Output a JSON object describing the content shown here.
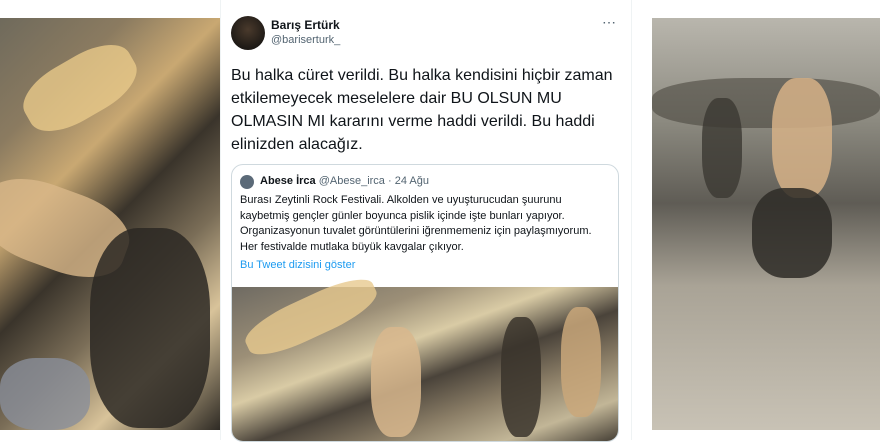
{
  "images": {
    "left": "crowd-photo-left",
    "right": "crowd-photo-right"
  },
  "tweet": {
    "author_name": "Barış Ertürk",
    "author_handle": "@bariserturk_",
    "more_icon": "⋯",
    "text": "Bu halka cüret verildi. Bu halka kendisini hiçbir zaman etkilemeyecek meselelere dair BU OLSUN MU OLMASIN MI kararını verme haddi verildi. Bu haddi elinizden alacağız.",
    "quote": {
      "author_name": "Abese İrca",
      "author_handle": "@Abese_irca",
      "date": "· 24 Ağu",
      "text": "Burası Zeytinli Rock Festivali. Alkolden ve uyuşturucudan şuurunu kaybetmiş gençler günler boyunca pislik içinde işte bunları yapıyor. Organizasyonun tuvalet görüntülerini iğrenmemeniz için paylaşmıyorum. Her festivalde mutlaka büyük kavgalar çıkıyor.",
      "thread_link": "Bu Tweet dizisini göster"
    }
  },
  "colors": {
    "text": "#0f1419",
    "secondary": "#536471",
    "link": "#1d9bf0",
    "border": "#cfd9de"
  }
}
